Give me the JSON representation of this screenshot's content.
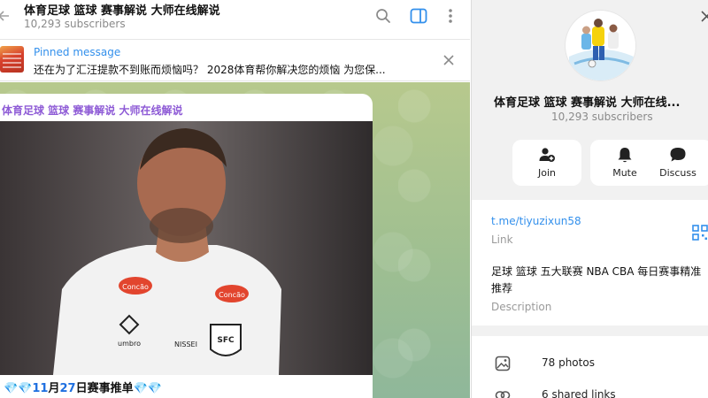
{
  "header": {
    "title": "体育足球 篮球 赛事解说 大师在线解说",
    "subtitle": "10,293 subscribers"
  },
  "pinned": {
    "label": "Pinned message",
    "text": "还在为了汇汪提款不到账而烦恼吗？ 2028体育帮你解决您的烦恼 为您保..."
  },
  "message": {
    "sender": "体育足球 篮球 赛事解说 大师在线解说",
    "caption_prefix": "💎💎",
    "caption_digits_1": "11",
    "caption_month": "月",
    "caption_digits_2": "27",
    "caption_text": "日赛事推单",
    "caption_suffix": "💎💎",
    "photo_jersey_sponsor": "Concão",
    "photo_jersey_brand": "umbro",
    "photo_jersey_text": "NISSEI",
    "photo_crest": "SFC"
  },
  "info": {
    "title": "体育足球 篮球 赛事解说 大师在线...",
    "subscribers": "10,293 subscribers",
    "actions": {
      "join": "Join",
      "mute": "Mute",
      "discuss": "Discuss"
    },
    "link": {
      "value": "t.me/tiyuzixun58",
      "label": "Link"
    },
    "description": {
      "value": "足球 篮球 五大联赛 NBA  CBA 每日赛事精准推荐",
      "label": "Description"
    },
    "media": {
      "photos": "78 photos",
      "links": "6 shared links"
    }
  },
  "colors": {
    "accent": "#3390ec",
    "sender": "#8e5bd6",
    "chat_background": "#a9c28f"
  }
}
